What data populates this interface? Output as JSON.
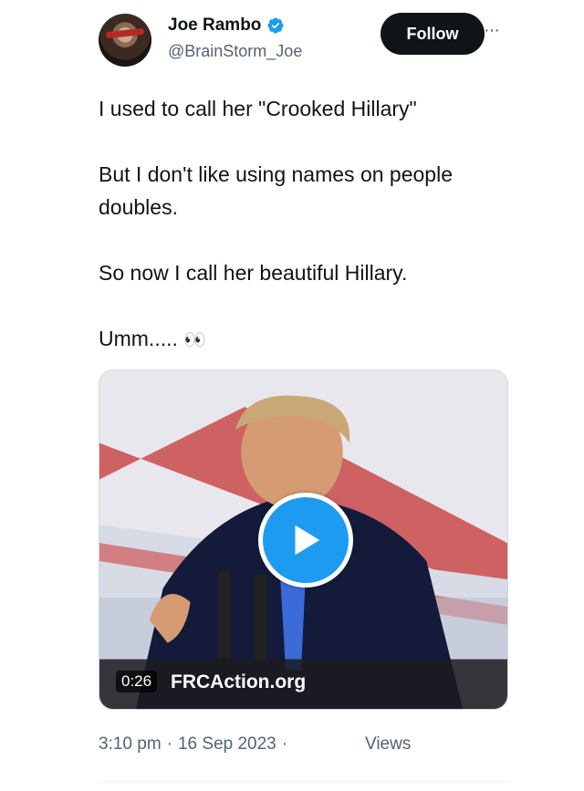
{
  "author": {
    "display_name": "Joe Rambo",
    "handle": "@BrainStorm_Joe",
    "verified": true,
    "avatar_icon": "profile-photo"
  },
  "actions": {
    "follow_label": "Follow",
    "more_label": "···"
  },
  "tweet": {
    "lines": [
      "I used to call her \"Crooked Hillary\"",
      "But I don't like using names on people doubles.",
      "So now I call her beautiful Hillary.",
      "Umm....."
    ],
    "emoji": "👀"
  },
  "media": {
    "duration": "0:26",
    "overlay_text": "FRCAction.org",
    "play_icon": "play-icon"
  },
  "footer": {
    "time": "3:10 pm",
    "separator": "·",
    "date": "16 Sep 2023",
    "views_label": "Views"
  },
  "colors": {
    "accent": "#1d9bf0",
    "text_primary": "#0f1419",
    "text_secondary": "#536471",
    "button_bg": "#0f1419"
  }
}
